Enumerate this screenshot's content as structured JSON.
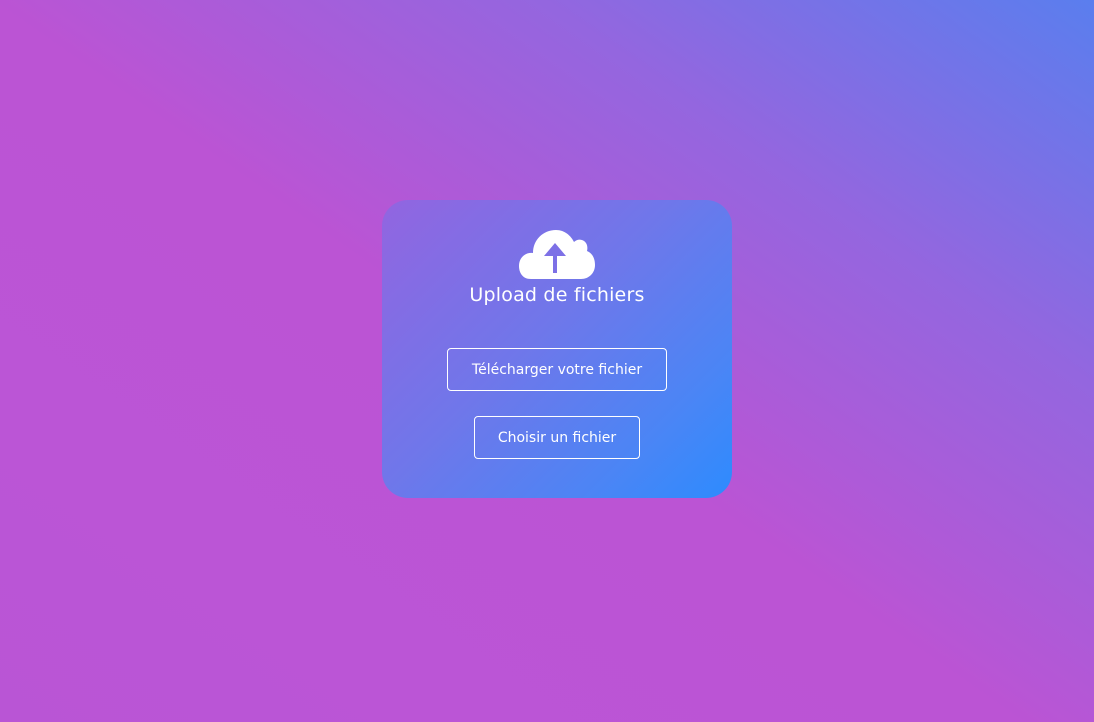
{
  "card": {
    "icon": "cloud-upload-icon",
    "title": "Upload de fichiers",
    "upload_button_label": "Télécharger votre fichier",
    "choose_button_label": "Choisir un fichier"
  },
  "colors": {
    "background_top_right": "#5a7eee",
    "background_main": "#bb55d6",
    "card_top_left": "#9265e0",
    "card_bottom_right": "#2d8bfe",
    "text": "#ffffff"
  }
}
